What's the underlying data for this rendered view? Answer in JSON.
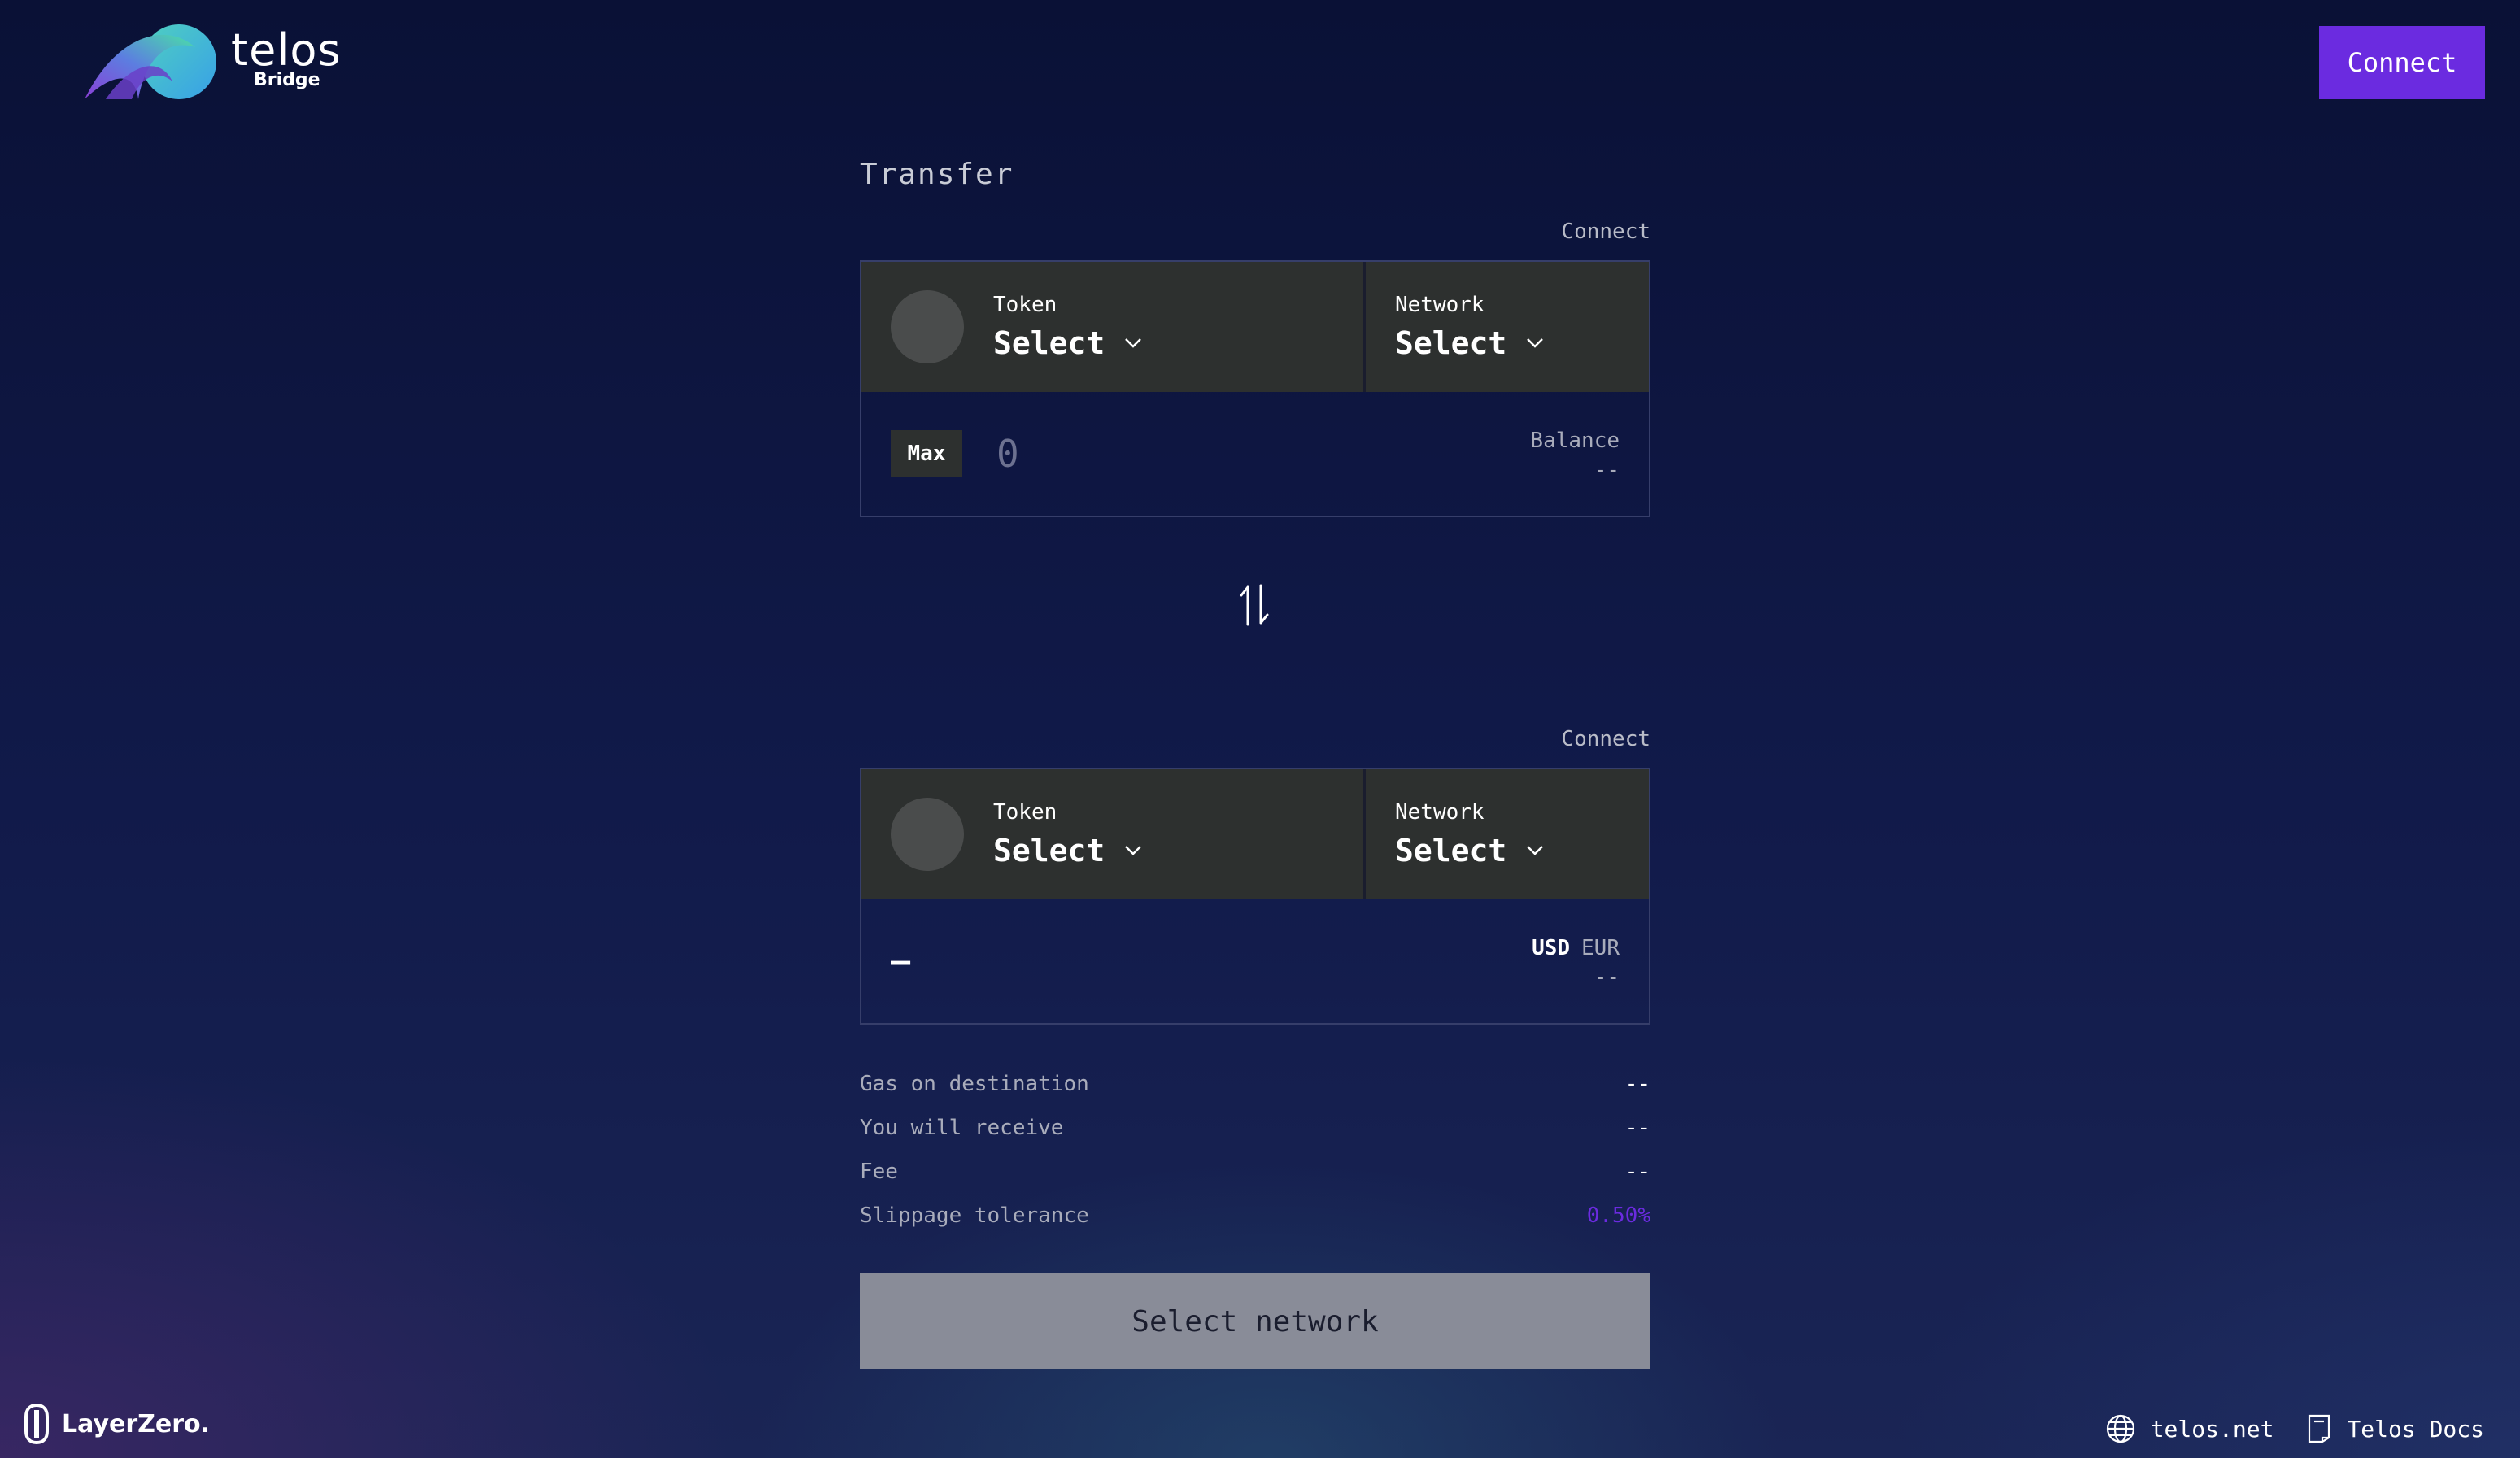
{
  "header": {
    "logo_word": "telos",
    "logo_sub": "Bridge",
    "connect_label": "Connect"
  },
  "transfer": {
    "title": "Transfer",
    "from": {
      "connect_label": "Connect",
      "token_label": "Token",
      "token_value": "Select",
      "network_label": "Network",
      "network_value": "Select",
      "max_label": "Max",
      "amount_placeholder": "0",
      "balance_label": "Balance",
      "balance_value": "--"
    },
    "to": {
      "connect_label": "Connect",
      "token_label": "Token",
      "token_value": "Select",
      "network_label": "Network",
      "network_value": "Select",
      "amount_value": "–",
      "currency_usd": "USD",
      "currency_eur": "EUR",
      "currency_value": "--"
    }
  },
  "details": [
    {
      "label": "Gas on destination",
      "value": "--"
    },
    {
      "label": "You will receive",
      "value": "--"
    },
    {
      "label": "Fee",
      "value": "--"
    },
    {
      "label": "Slippage tolerance",
      "value": "0.50%"
    }
  ],
  "action_button": "Select network",
  "footer": {
    "brand": "LayerZero.",
    "links": [
      {
        "icon": "globe-icon",
        "label": "telos.net"
      },
      {
        "icon": "docs-icon",
        "label": "Telos Docs"
      }
    ]
  },
  "colors": {
    "accent": "#6b2be0",
    "panel": "#2d302f",
    "button_disabled": "#898c98"
  }
}
